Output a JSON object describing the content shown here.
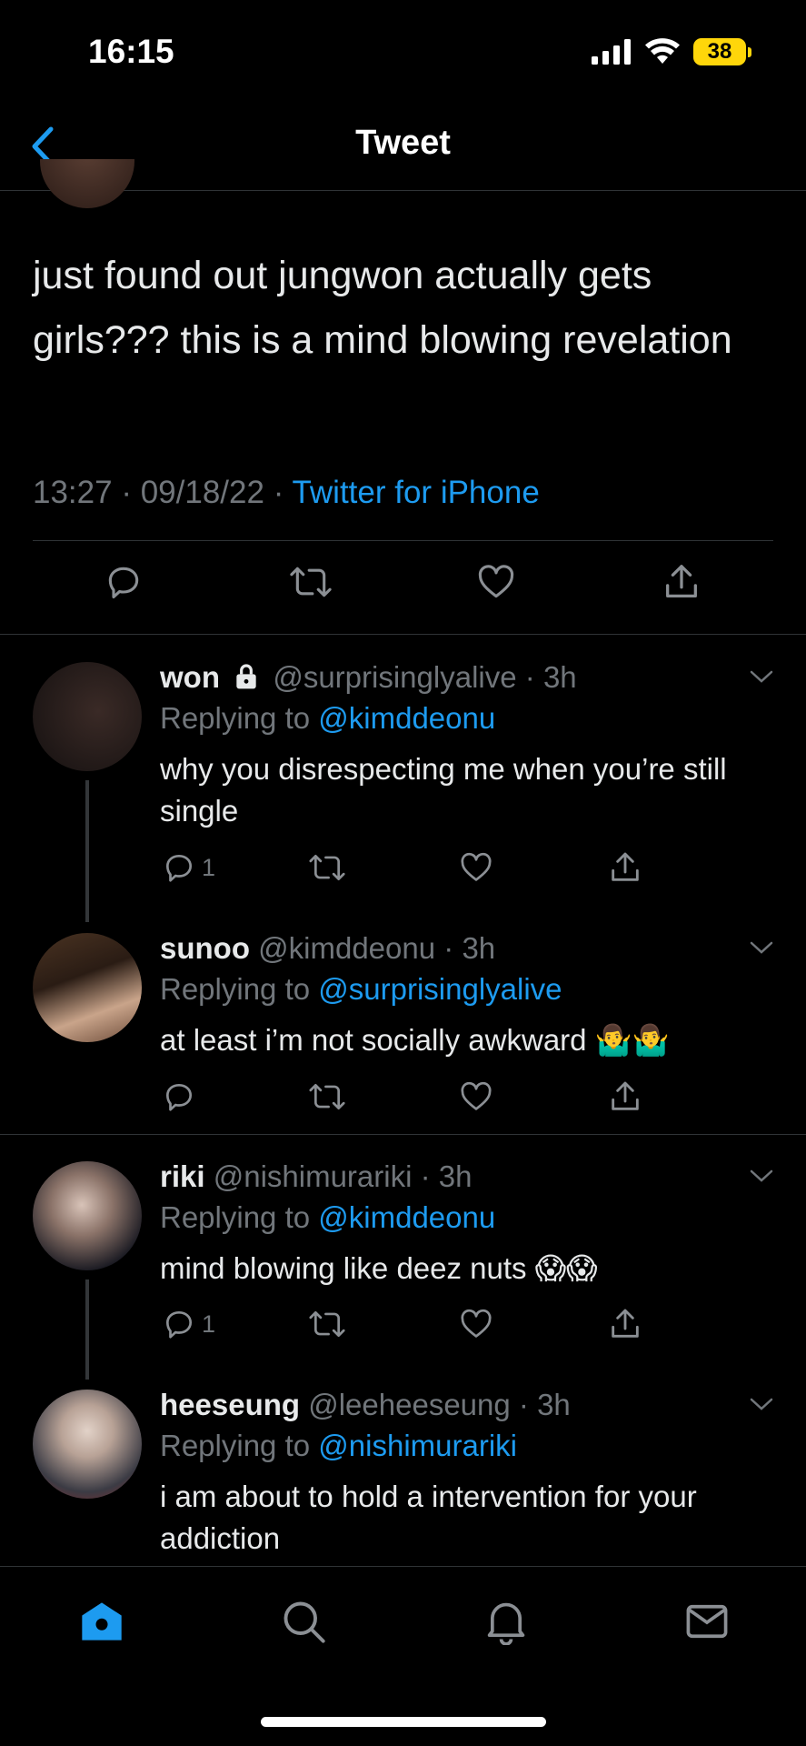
{
  "status_bar": {
    "time": "16:15",
    "battery": "38"
  },
  "nav": {
    "title": "Tweet"
  },
  "main_tweet": {
    "text": "just found out jungwon actually gets girls??? this is a mind blowing revelation",
    "time": "13:27",
    "date": "09/18/22",
    "source": "Twitter for iPhone",
    "separator": "·"
  },
  "replies": [
    {
      "name": "won",
      "handle": "@surprisinglyalive",
      "age": "3h",
      "locked": true,
      "replying_prefix": "Replying to",
      "replying_to": "@kimddeonu",
      "text": "why you disrespecting me when you’re still single",
      "reply_count": "1"
    },
    {
      "name": "sunoo",
      "handle": "@kimddeonu",
      "age": "3h",
      "locked": false,
      "replying_prefix": "Replying to",
      "replying_to": "@surprisinglyalive",
      "text": "at least i’m not socially awkward 🤷‍♂️🤷‍♂️",
      "reply_count": ""
    },
    {
      "name": "riki",
      "handle": "@nishimurariki",
      "age": "3h",
      "locked": false,
      "replying_prefix": "Replying to",
      "replying_to": "@kimddeonu",
      "text": "mind blowing like deez nuts 😱😱",
      "reply_count": "1"
    },
    {
      "name": "heeseung",
      "handle": "@leeheeseung",
      "age": "3h",
      "locked": false,
      "replying_prefix": "Replying to",
      "replying_to": "@nishimurariki",
      "text": "i am about to hold a intervention for your addiction",
      "reply_count": ""
    }
  ],
  "icons": {
    "reply": "reply-icon",
    "retweet": "retweet-icon",
    "like": "heart-icon",
    "share": "share-icon",
    "home": "home-icon",
    "search": "search-icon",
    "notifications": "bell-icon",
    "messages": "mail-icon"
  },
  "colors": {
    "background": "#000000",
    "accent": "#1d9bf0",
    "secondary_text": "#71767b",
    "primary_text": "#e7e9ea",
    "battery": "#ffd60a"
  }
}
